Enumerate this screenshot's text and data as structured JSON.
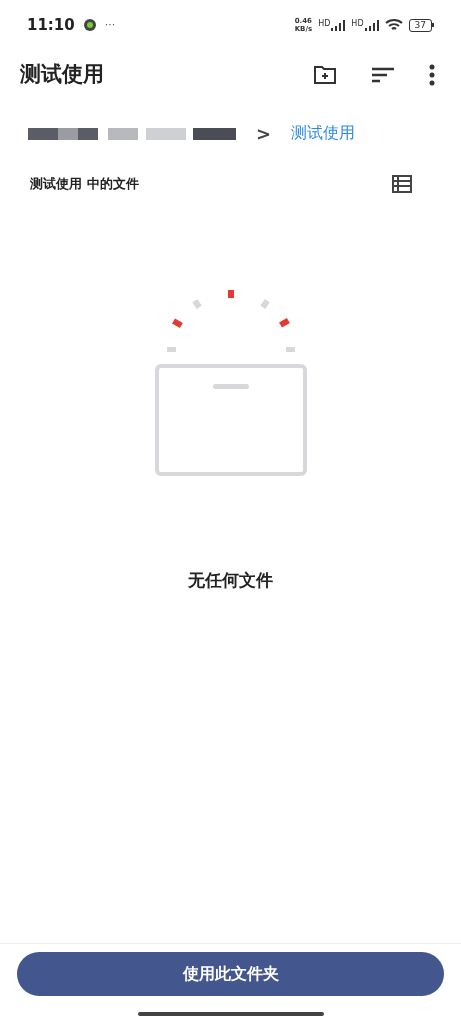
{
  "status_bar": {
    "time": "11:10",
    "more": "···",
    "speed_value": "0.46",
    "speed_unit": "KB/s",
    "signal_labels": [
      "HD",
      "HD"
    ],
    "battery": "37"
  },
  "app_bar": {
    "title": "测试使用"
  },
  "breadcrumb": {
    "separator": ">",
    "current": "测试使用"
  },
  "section": {
    "title": "测试使用 中的文件"
  },
  "empty": {
    "message": "无任何文件"
  },
  "primary_button": {
    "label": "使用此文件夹"
  }
}
